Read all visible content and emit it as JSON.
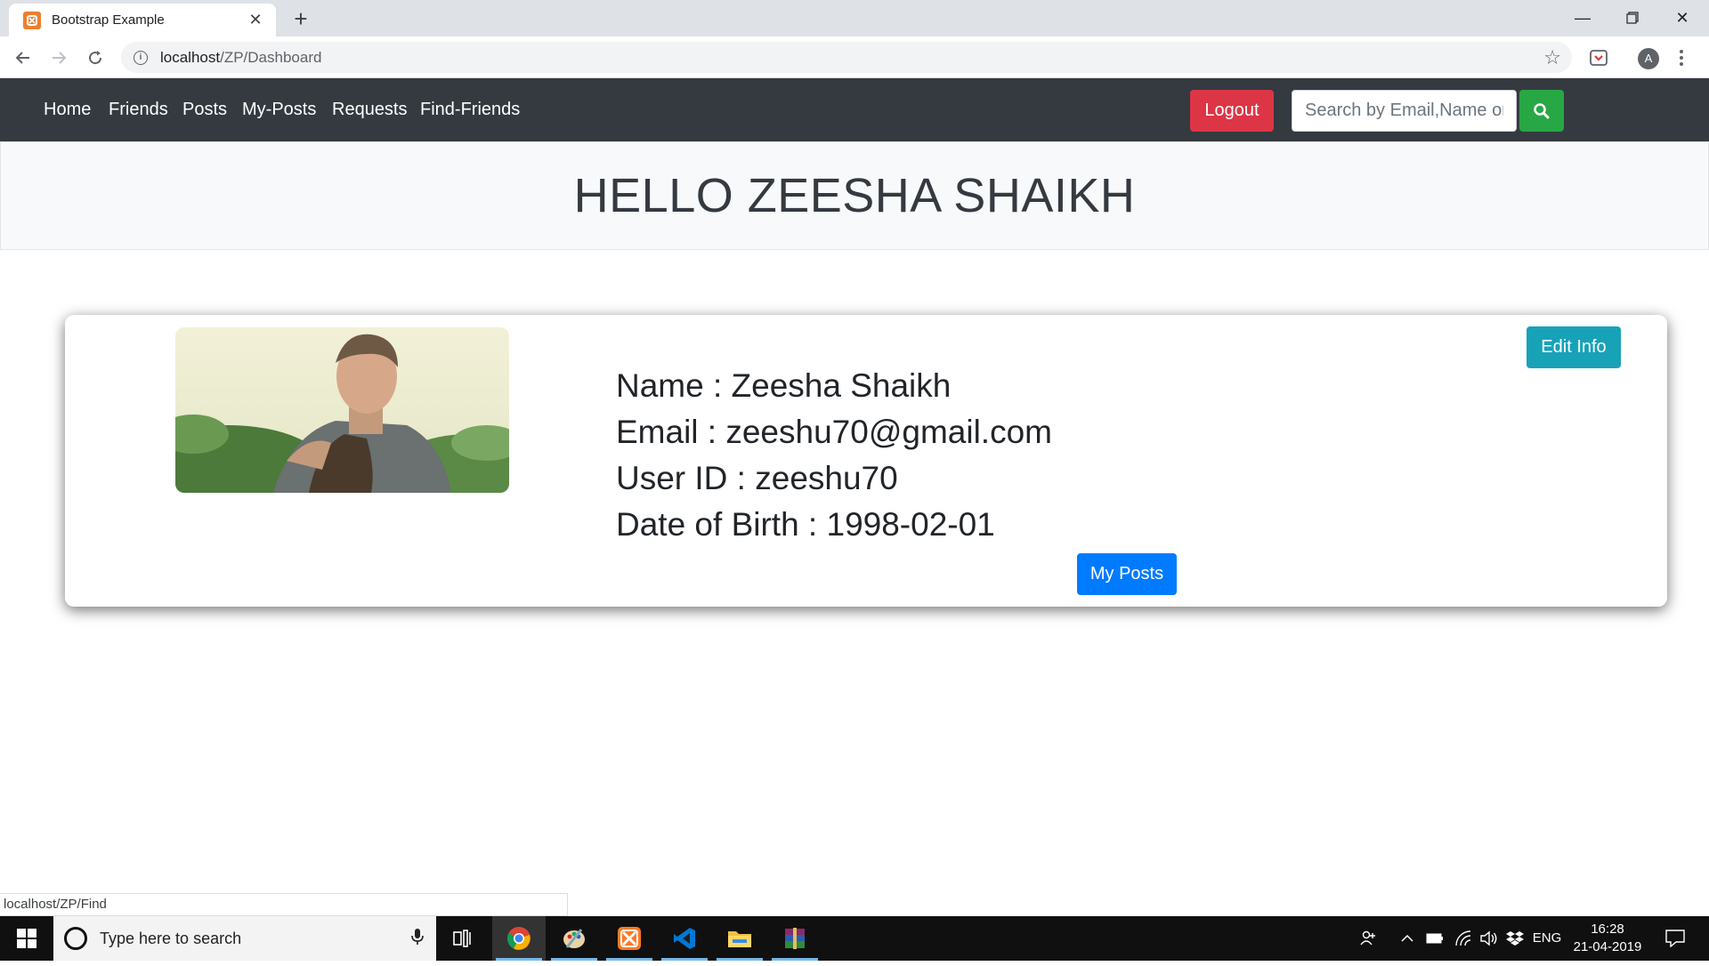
{
  "browser": {
    "tab_title": "Bootstrap Example",
    "url_host": "localhost",
    "url_path": "/ZP/Dashboard",
    "status_url": "localhost/ZP/Find",
    "profile_initial": "A"
  },
  "navbar": {
    "links": [
      "Home",
      "Friends",
      "Posts",
      "My-Posts",
      "Requests",
      "Find-Friends"
    ],
    "logout_label": "Logout",
    "search_placeholder": "Search by Email,Name or"
  },
  "greeting": "HELLO ZEESHA SHAIKH",
  "profile": {
    "name_line": "Name : Zeesha Shaikh",
    "email_line": "Email : zeeshu70@gmail.com",
    "userid_line": "User ID : zeeshu70",
    "dob_line": "Date of Birth : 1998-02-01",
    "edit_label": "Edit Info",
    "myposts_label": "My Posts"
  },
  "taskbar": {
    "search_placeholder": "Type here to search",
    "language": "ENG",
    "time": "16:28",
    "date": "21-04-2019"
  },
  "colors": {
    "navbar_bg": "#343a40",
    "logout": "#dc3545",
    "search_btn": "#28a745",
    "edit_btn": "#17a2b8",
    "primary_btn": "#007bff"
  },
  "icons": [
    "back-arrow-icon",
    "forward-arrow-icon",
    "reload-icon",
    "info-icon",
    "star-icon",
    "pocket-extension-icon",
    "profile-avatar-icon",
    "kebab-menu-icon",
    "search-icon",
    "windows-start-icon",
    "microphone-icon",
    "task-view-icon",
    "chrome-icon",
    "paint-icon",
    "xampp-icon",
    "vscode-icon",
    "file-explorer-icon",
    "winrar-icon",
    "people-icon",
    "chevron-up-icon",
    "battery-icon",
    "wifi-icon",
    "volume-icon",
    "dropbox-icon",
    "action-center-icon"
  ]
}
